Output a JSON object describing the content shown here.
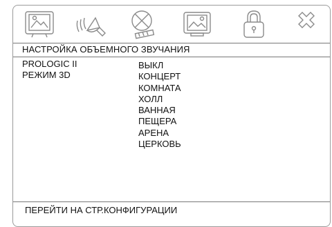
{
  "toolbar": {
    "icons": [
      {
        "name": "general-setup-icon"
      },
      {
        "name": "audio-setup-icon"
      },
      {
        "name": "dolby-setup-icon"
      },
      {
        "name": "video-setup-icon"
      },
      {
        "name": "password-setup-icon"
      },
      {
        "name": "exit-icon"
      }
    ],
    "line_color": "#8a8a8a"
  },
  "panel": {
    "title": "НАСТРОЙКА ОБЪЕМНОГО ЗВУЧАНИЯ",
    "menu": [
      "PROLOGIC II",
      "РЕЖИМ 3D"
    ],
    "options": [
      "ВЫКЛ",
      "КОНЦЕРТ",
      "КОМНАТА",
      "ХОЛЛ",
      "ВАННАЯ",
      "ПЕЩЕРА",
      "АРЕНА",
      "ЦЕРКОВЬ"
    ]
  },
  "footer": {
    "text": "ПЕРЕЙТИ НА СТР.КОНФИГУРАЦИИ"
  }
}
